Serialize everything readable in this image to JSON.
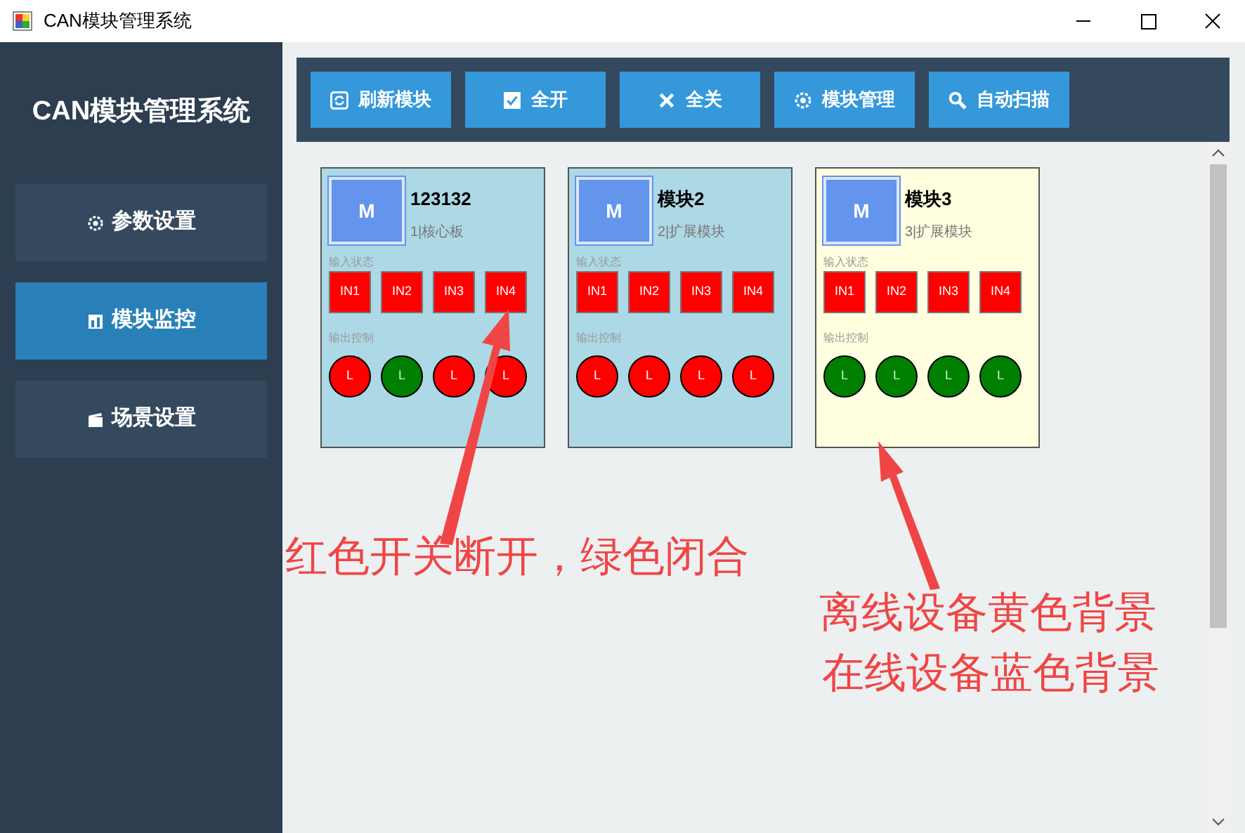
{
  "window": {
    "title": "CAN模块管理系统"
  },
  "sidebar": {
    "title": "CAN模块管理系统",
    "items": [
      {
        "label": "参数设置",
        "selected": false
      },
      {
        "label": "模块监控",
        "selected": true
      },
      {
        "label": "场景设置",
        "selected": false
      }
    ]
  },
  "toolbar": [
    {
      "label": "刷新模块"
    },
    {
      "label": "全开"
    },
    {
      "label": "全关"
    },
    {
      "label": "模块管理"
    },
    {
      "label": "自动扫描"
    }
  ],
  "modules": [
    {
      "avatar": "M",
      "name": "123132",
      "subtitle": "1|核心板",
      "online": true,
      "input_label": "输入状态",
      "output_label": "输出控制",
      "inputs": [
        {
          "label": "IN1",
          "closed": false
        },
        {
          "label": "IN2",
          "closed": false
        },
        {
          "label": "IN3",
          "closed": false
        },
        {
          "label": "IN4",
          "closed": false
        }
      ],
      "outputs": [
        {
          "label": "L",
          "on": false
        },
        {
          "label": "L",
          "on": true
        },
        {
          "label": "L",
          "on": false
        },
        {
          "label": "L",
          "on": false
        }
      ]
    },
    {
      "avatar": "M",
      "name": "模块2",
      "subtitle": "2|扩展模块",
      "online": true,
      "input_label": "输入状态",
      "output_label": "输出控制",
      "inputs": [
        {
          "label": "IN1",
          "closed": false
        },
        {
          "label": "IN2",
          "closed": false
        },
        {
          "label": "IN3",
          "closed": false
        },
        {
          "label": "IN4",
          "closed": false
        }
      ],
      "outputs": [
        {
          "label": "L",
          "on": false
        },
        {
          "label": "L",
          "on": false
        },
        {
          "label": "L",
          "on": false
        },
        {
          "label": "L",
          "on": false
        }
      ]
    },
    {
      "avatar": "M",
      "name": "模块3",
      "subtitle": "3|扩展模块",
      "online": false,
      "input_label": "输入状态",
      "output_label": "输出控制",
      "inputs": [
        {
          "label": "IN1",
          "closed": false
        },
        {
          "label": "IN2",
          "closed": false
        },
        {
          "label": "IN3",
          "closed": false
        },
        {
          "label": "IN4",
          "closed": false
        }
      ],
      "outputs": [
        {
          "label": "L",
          "on": true
        },
        {
          "label": "L",
          "on": true
        },
        {
          "label": "L",
          "on": true
        },
        {
          "label": "L",
          "on": true
        }
      ]
    }
  ],
  "annotations": [
    {
      "text": "红色开关断开，绿色闭合"
    },
    {
      "text": "离线设备黄色背景"
    },
    {
      "text": "在线设备蓝色背景"
    }
  ]
}
